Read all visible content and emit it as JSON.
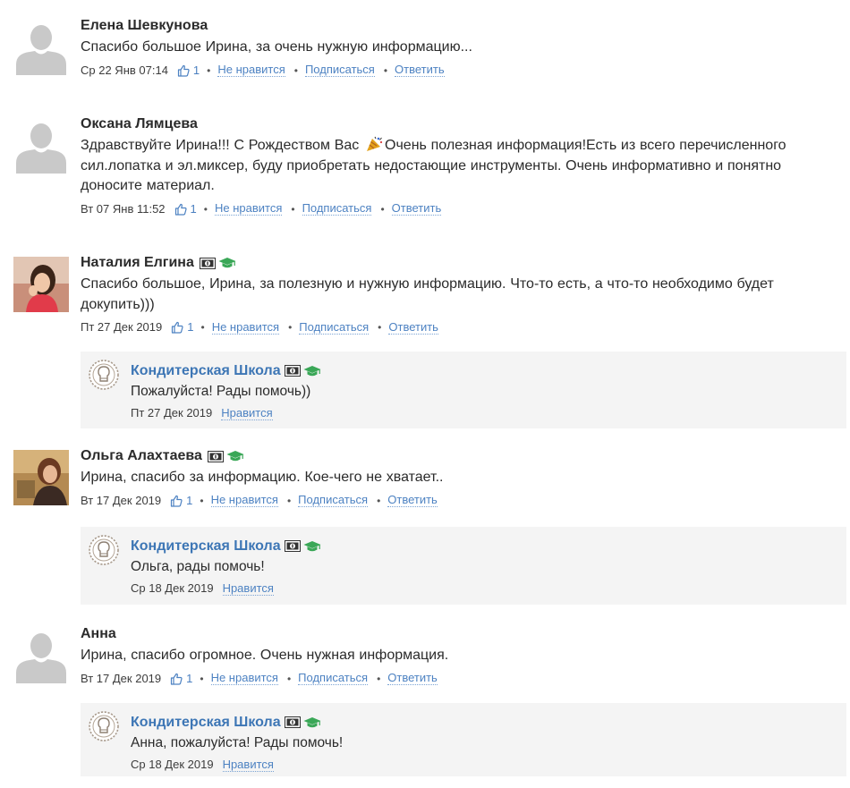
{
  "actions": {
    "dislike": "Не нравится",
    "subscribe": "Подписаться",
    "reply": "Ответить",
    "like": "Нравится",
    "separator": "•"
  },
  "colors": {
    "link": "#4d82c2",
    "reply_author": "#3d76b5",
    "reply_bg": "#f4f4f4",
    "badge_cap": "#3aa757"
  },
  "comments": [
    {
      "author": "Елена Шевкунова",
      "text": "Спасибо большое Ирина, за очень нужную информацию...",
      "date": "Ср 22 Янв 07:14",
      "likes": "1",
      "avatar": "default-avatar-icon"
    },
    {
      "author": "Оксана Лямцева",
      "text_before": "Здравствуйте Ирина!!! С Рождеством Вас ",
      "text_after": "Очень полезная информация!Есть из всего перечисленного сил.лопатка и эл.миксер, буду приобретать недостающие инструменты. Очень информативно и понятно доносите материал.",
      "emoji": "party-popper-icon",
      "date": "Вт 07 Янв 11:52",
      "likes": "1",
      "avatar": "default-avatar-icon"
    },
    {
      "author": "Наталия Елгина",
      "text": "Спасибо большое, Ирина, за полезную и нужную информацию. Что-то есть, а что-то необходимо будет докупить)))",
      "date": "Пт 27 Дек 2019",
      "likes": "1",
      "avatar": "user-photo",
      "reply": {
        "author": "Кондитерская Школа",
        "text": "Пожалуйста! Рады помочь))",
        "date": "Пт 27 Дек 2019"
      }
    },
    {
      "author": "Ольга Алахтаева",
      "text": "Ирина, спасибо за информацию. Кое-чего не хватает..",
      "date": "Вт 17 Дек 2019",
      "likes": "1",
      "avatar": "user-photo",
      "reply": {
        "author": "Кондитерская Школа",
        "text": "Ольга, рады помочь!",
        "date": "Ср 18 Дек 2019"
      }
    },
    {
      "author": "Анна",
      "text": "Ирина, спасибо огромное. Очень нужная информация.",
      "date": "Вт 17 Дек 2019",
      "likes": "1",
      "avatar": "default-avatar-icon",
      "reply": {
        "author": "Кондитерская Школа",
        "text": "Анна, пожалуйста! Рады помочь!",
        "date": "Ср 18 Дек 2019"
      }
    }
  ]
}
